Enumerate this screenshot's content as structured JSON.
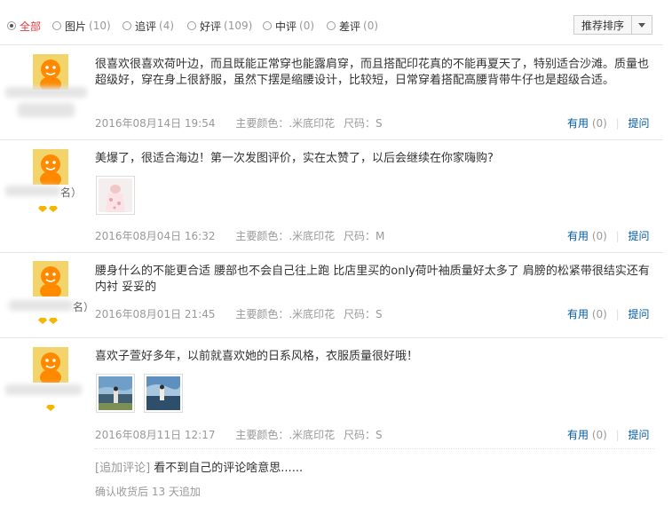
{
  "filters": [
    {
      "label": "全部",
      "count": "",
      "active": true
    },
    {
      "label": "图片",
      "count": "(10)",
      "active": false
    },
    {
      "label": "追评",
      "count": "(4)",
      "active": false
    },
    {
      "label": "好评",
      "count": "(109)",
      "active": false
    },
    {
      "label": "中评",
      "count": "(0)",
      "active": false
    },
    {
      "label": "差评",
      "count": "(0)",
      "active": false
    }
  ],
  "sort": {
    "label": "推荐排序"
  },
  "meta_labels": {
    "color": "主要颜色：",
    "size": "尺码：",
    "useful": "有用",
    "ask": "提问"
  },
  "reviews": [
    {
      "user_suffix": "",
      "text": "很喜欢很喜欢荷叶边，而且既能正常穿也能露肩穿，而且搭配印花真的不能再夏天了，特别适合沙滩。质量也超级好，穿在身上很舒服，虽然下摆是缩腰设计，比较短，日常穿着搭配高腰背带牛仔也是超级合适。",
      "date": "2016年08月14日 19:54",
      "color": ".米底印花",
      "size": "S",
      "useful_count": "(0)"
    },
    {
      "user_suffix": "名）",
      "text": "美爆了，很适合海边！第一次发图评价，实在太赞了，以后会继续在你家嗨购?",
      "date": "2016年08月04日 16:32",
      "color": ".米底印花",
      "size": "M",
      "useful_count": "(0)"
    },
    {
      "user_suffix": "名）",
      "text": "腰身什么的不能更合适 腰部也不会自己往上跑 比店里买的only荷叶袖质量好太多了 肩膀的松紧带很结实还有内衬 妥妥的",
      "date": "2016年08月01日 21:45",
      "color": ".米底印花",
      "size": "S",
      "useful_count": "(0)"
    },
    {
      "user_suffix": "",
      "text": "喜欢子萱好多年，以前就喜欢她的日系风格，衣服质量很好哦！",
      "date": "2016年08月11日 12:17",
      "color": ".米底印花",
      "size": "S",
      "useful_count": "(0)",
      "followup_tag": "[追加评论]",
      "followup_text": "看不到自己的评论啥意思......",
      "added_note": "确认收货后 13 天追加"
    }
  ],
  "icons": [
    "radio-icon",
    "chevron-down-icon",
    "avatar-icon",
    "medal-icon"
  ]
}
